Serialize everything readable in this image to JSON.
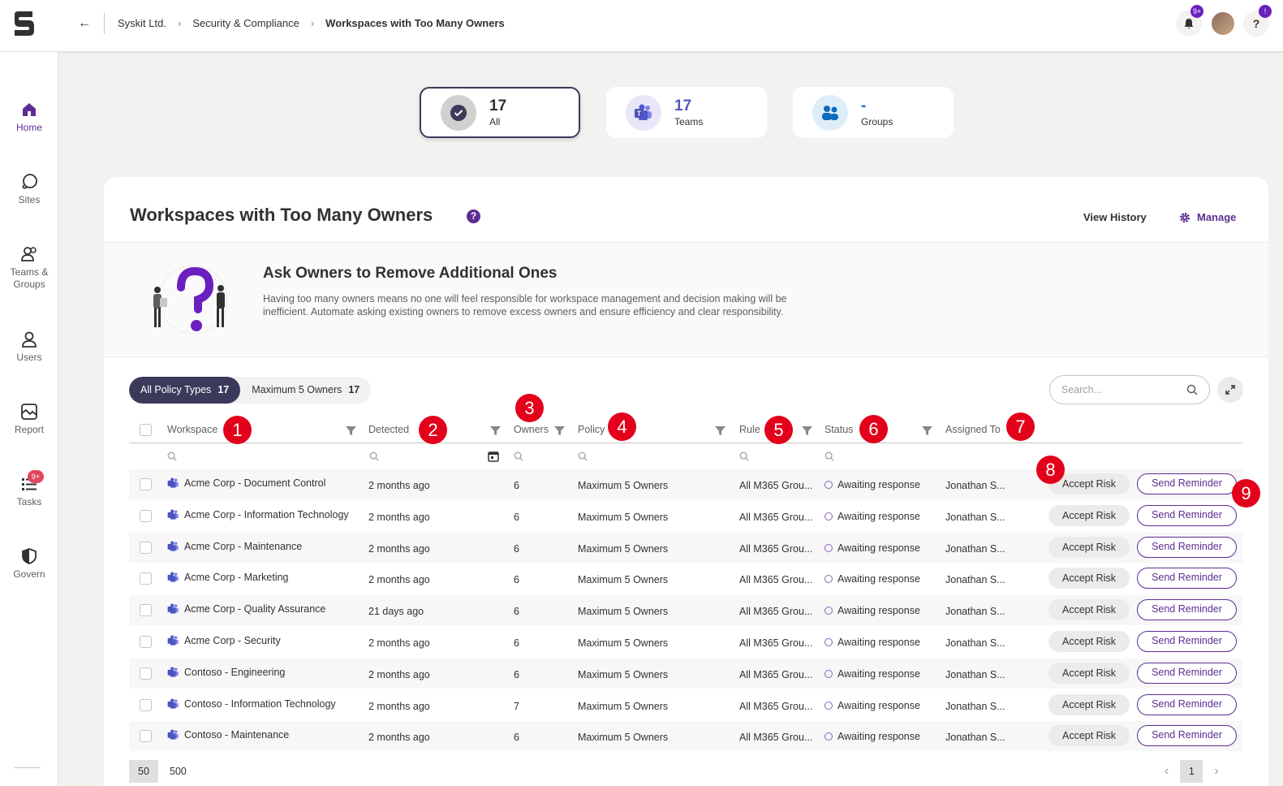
{
  "breadcrumb": {
    "org": "Syskit Ltd.",
    "section": "Security & Compliance",
    "current": "Workspaces with Too Many Owners"
  },
  "topbar": {
    "notification_badge": "9+",
    "help_badge": "!",
    "help_label": "?"
  },
  "sidebar": {
    "items": [
      {
        "label": "Home",
        "icon": "home-icon"
      },
      {
        "label": "Sites",
        "icon": "globe-icon"
      },
      {
        "label": "Teams & Groups",
        "icon": "people-icon"
      },
      {
        "label": "Users",
        "icon": "user-icon"
      },
      {
        "label": "Report",
        "icon": "report-icon"
      },
      {
        "label": "Tasks",
        "icon": "tasks-icon",
        "badge": "9+"
      },
      {
        "label": "Govern",
        "icon": "shield-icon"
      }
    ]
  },
  "summary_cards": [
    {
      "number": "17",
      "label": "All"
    },
    {
      "number": "17",
      "label": "Teams"
    },
    {
      "number": "-",
      "label": "Groups"
    }
  ],
  "panel": {
    "title": "Workspaces with Too Many Owners",
    "help_label": "?",
    "view_history": "View History",
    "manage": "Manage"
  },
  "banner": {
    "title": "Ask Owners to Remove Additional Ones",
    "description": "Having too many owners means no one will feel responsible for workspace management and decision making will be inefficient. Automate asking existing owners to remove excess owners and ensure efficiency and clear responsibility."
  },
  "filters": {
    "pills": [
      {
        "label": "All Policy Types",
        "count": "17"
      },
      {
        "label": "Maximum 5 Owners",
        "count": "17"
      }
    ],
    "search_placeholder": "Search..."
  },
  "table": {
    "columns": [
      "Workspace",
      "Detected",
      "Owners",
      "Policy",
      "Rule",
      "Status",
      "Assigned To"
    ],
    "rows": [
      {
        "workspace": "Acme Corp - Document Control",
        "detected": "2 months ago",
        "owners": "6",
        "policy": "Maximum 5 Owners",
        "rule": "All M365 Grou...",
        "status": "Awaiting response",
        "assigned": "Jonathan S..."
      },
      {
        "workspace": "Acme Corp - Information Technology",
        "detected": "2 months ago",
        "owners": "6",
        "policy": "Maximum 5 Owners",
        "rule": "All M365 Grou...",
        "status": "Awaiting response",
        "assigned": "Jonathan S..."
      },
      {
        "workspace": "Acme Corp - Maintenance",
        "detected": "2 months ago",
        "owners": "6",
        "policy": "Maximum 5 Owners",
        "rule": "All M365 Grou...",
        "status": "Awaiting response",
        "assigned": "Jonathan S..."
      },
      {
        "workspace": "Acme Corp - Marketing",
        "detected": "2 months ago",
        "owners": "6",
        "policy": "Maximum 5 Owners",
        "rule": "All M365 Grou...",
        "status": "Awaiting response",
        "assigned": "Jonathan S..."
      },
      {
        "workspace": "Acme Corp - Quality Assurance",
        "detected": "21 days ago",
        "owners": "6",
        "policy": "Maximum 5 Owners",
        "rule": "All M365 Grou...",
        "status": "Awaiting response",
        "assigned": "Jonathan S..."
      },
      {
        "workspace": "Acme Corp - Security",
        "detected": "2 months ago",
        "owners": "6",
        "policy": "Maximum 5 Owners",
        "rule": "All M365 Grou...",
        "status": "Awaiting response",
        "assigned": "Jonathan S..."
      },
      {
        "workspace": "Contoso - Engineering",
        "detected": "2 months ago",
        "owners": "6",
        "policy": "Maximum 5 Owners",
        "rule": "All M365 Grou...",
        "status": "Awaiting response",
        "assigned": "Jonathan S..."
      },
      {
        "workspace": "Contoso - Information Technology",
        "detected": "2 months ago",
        "owners": "7",
        "policy": "Maximum 5 Owners",
        "rule": "All M365 Grou...",
        "status": "Awaiting response",
        "assigned": "Jonathan S..."
      },
      {
        "workspace": "Contoso - Maintenance",
        "detected": "2 months ago",
        "owners": "6",
        "policy": "Maximum 5 Owners",
        "rule": "All M365 Grou...",
        "status": "Awaiting response",
        "assigned": "Jonathan S..."
      }
    ],
    "accept_label": "Accept Risk",
    "reminder_label": "Send Reminder"
  },
  "pagination": {
    "sizes": [
      "50",
      "500"
    ],
    "current_page": "1"
  },
  "markers": [
    "1",
    "2",
    "3",
    "4",
    "5",
    "6",
    "7",
    "8",
    "9"
  ],
  "colors": {
    "accent": "#5c2d91",
    "selected_card": "#3b3a5a",
    "marker": "#e3001b"
  }
}
